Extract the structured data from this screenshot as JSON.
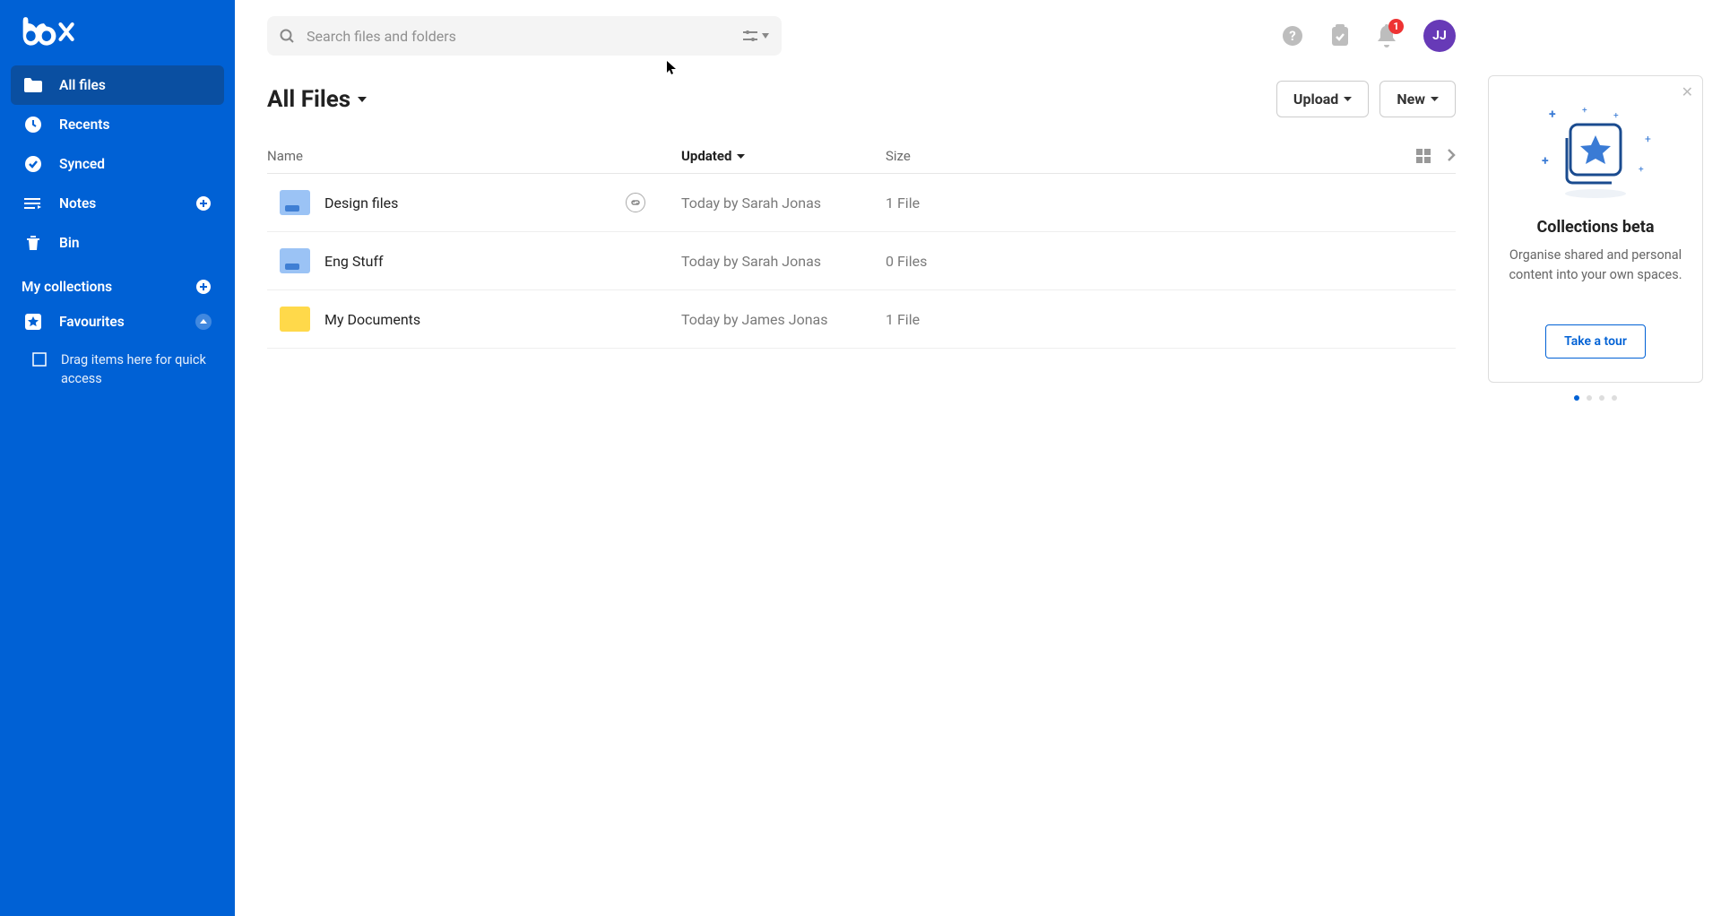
{
  "sidebar": {
    "items": [
      {
        "label": "All files"
      },
      {
        "label": "Recents"
      },
      {
        "label": "Synced"
      },
      {
        "label": "Notes"
      },
      {
        "label": "Bin"
      }
    ],
    "collections_header": "My collections",
    "favourites_label": "Favourites",
    "drop_hint": "Drag items here for quick access"
  },
  "search": {
    "placeholder": "Search files and folders"
  },
  "header": {
    "notification_count": "1",
    "avatar_initials": "JJ"
  },
  "title": "All Files",
  "buttons": {
    "upload": "Upload",
    "new": "New"
  },
  "columns": {
    "name": "Name",
    "updated": "Updated",
    "size": "Size"
  },
  "rows": [
    {
      "name": "Design files",
      "updated": "Today by Sarah Jonas",
      "size": "1 File",
      "folder": "blue",
      "has_link": true
    },
    {
      "name": "Eng Stuff",
      "updated": "Today by Sarah Jonas",
      "size": "0 Files",
      "folder": "blue",
      "has_link": false
    },
    {
      "name": "My Documents",
      "updated": "Today by James Jonas",
      "size": "1 File",
      "folder": "yellow",
      "has_link": false
    }
  ],
  "promo": {
    "title": "Collections beta",
    "body": "Organise shared and personal content into your own spaces.",
    "cta": "Take a tour"
  }
}
